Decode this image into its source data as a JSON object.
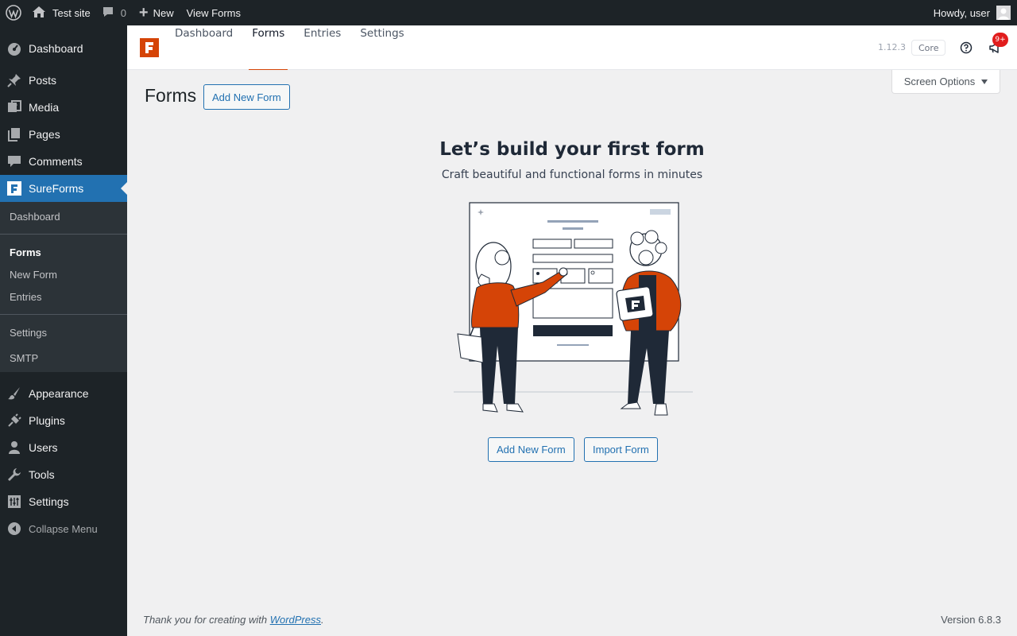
{
  "admin_bar": {
    "site_name": "Test site",
    "comments_count": "0",
    "new_label": "New",
    "view_label": "View Forms",
    "greeting": "Howdy, user"
  },
  "sidebar": {
    "items": [
      {
        "label": "Dashboard",
        "icon": "dashboard-icon"
      },
      {
        "label": "Posts",
        "icon": "pin-icon"
      },
      {
        "label": "Media",
        "icon": "media-icon"
      },
      {
        "label": "Pages",
        "icon": "pages-icon"
      },
      {
        "label": "Comments",
        "icon": "comment-icon"
      },
      {
        "label": "SureForms",
        "icon": "sureforms-icon"
      },
      {
        "label": "Appearance",
        "icon": "brush-icon"
      },
      {
        "label": "Plugins",
        "icon": "plug-icon"
      },
      {
        "label": "Users",
        "icon": "user-icon"
      },
      {
        "label": "Tools",
        "icon": "wrench-icon"
      },
      {
        "label": "Settings",
        "icon": "settings-icon"
      }
    ],
    "submenu": [
      "Dashboard",
      "Forms",
      "New Form",
      "Entries",
      "Settings",
      "SMTP"
    ],
    "collapse_label": "Collapse Menu"
  },
  "plugin_header": {
    "tabs": [
      "Dashboard",
      "Forms",
      "Entries",
      "Settings"
    ],
    "version": "1.12.3",
    "badge": "Core",
    "notifications": "9+"
  },
  "screen_options": "Screen Options",
  "page": {
    "title": "Forms",
    "add_new_label": "Add New Form"
  },
  "empty_state": {
    "heading": "Let’s build your first form",
    "subheading": "Craft beautiful and functional forms in minutes",
    "add_label": "Add New Form",
    "import_label": "Import Form"
  },
  "footer": {
    "thanks_prefix": "Thank you for creating with ",
    "thanks_link": "WordPress",
    "thanks_suffix": ".",
    "version": "Version 6.8.3"
  },
  "colors": {
    "admin_dark": "#1d2327",
    "wp_blue": "#2271b1",
    "brand_orange": "#d54407"
  }
}
